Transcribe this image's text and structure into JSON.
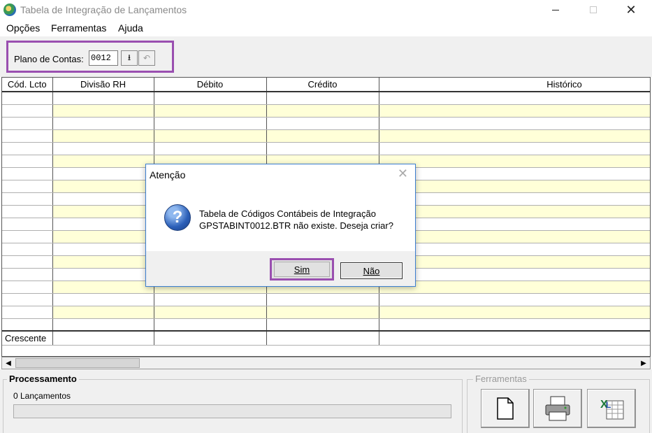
{
  "window": {
    "title": "Tabela de Integração de Lançamentos"
  },
  "menu": [
    "Opções",
    "Ferramentas",
    "Ajuda"
  ],
  "toolbar": {
    "plano_label": "Plano de Contas:",
    "plano_value": "0012"
  },
  "grid": {
    "columns": [
      "Cód. Lcto",
      "Divisão RH",
      "Débito",
      "Crédito",
      "Histórico"
    ],
    "footer_first": "Crescente"
  },
  "processamento": {
    "legend": "Processamento",
    "count_text": "0 Lançamentos"
  },
  "ferramentas": {
    "legend": "Ferramentas"
  },
  "dialog": {
    "title": "Atenção",
    "message_line1": "Tabela de Códigos Contábeis de Integração",
    "message_line2": "GPSTABINT0012.BTR não existe. Deseja criar?",
    "yes_label": "Sim",
    "no_label": "Não"
  },
  "colors": {
    "highlight": "#9a4fb0",
    "row_alt": "#ffffd8",
    "dialog_border": "#3c7fd1"
  }
}
